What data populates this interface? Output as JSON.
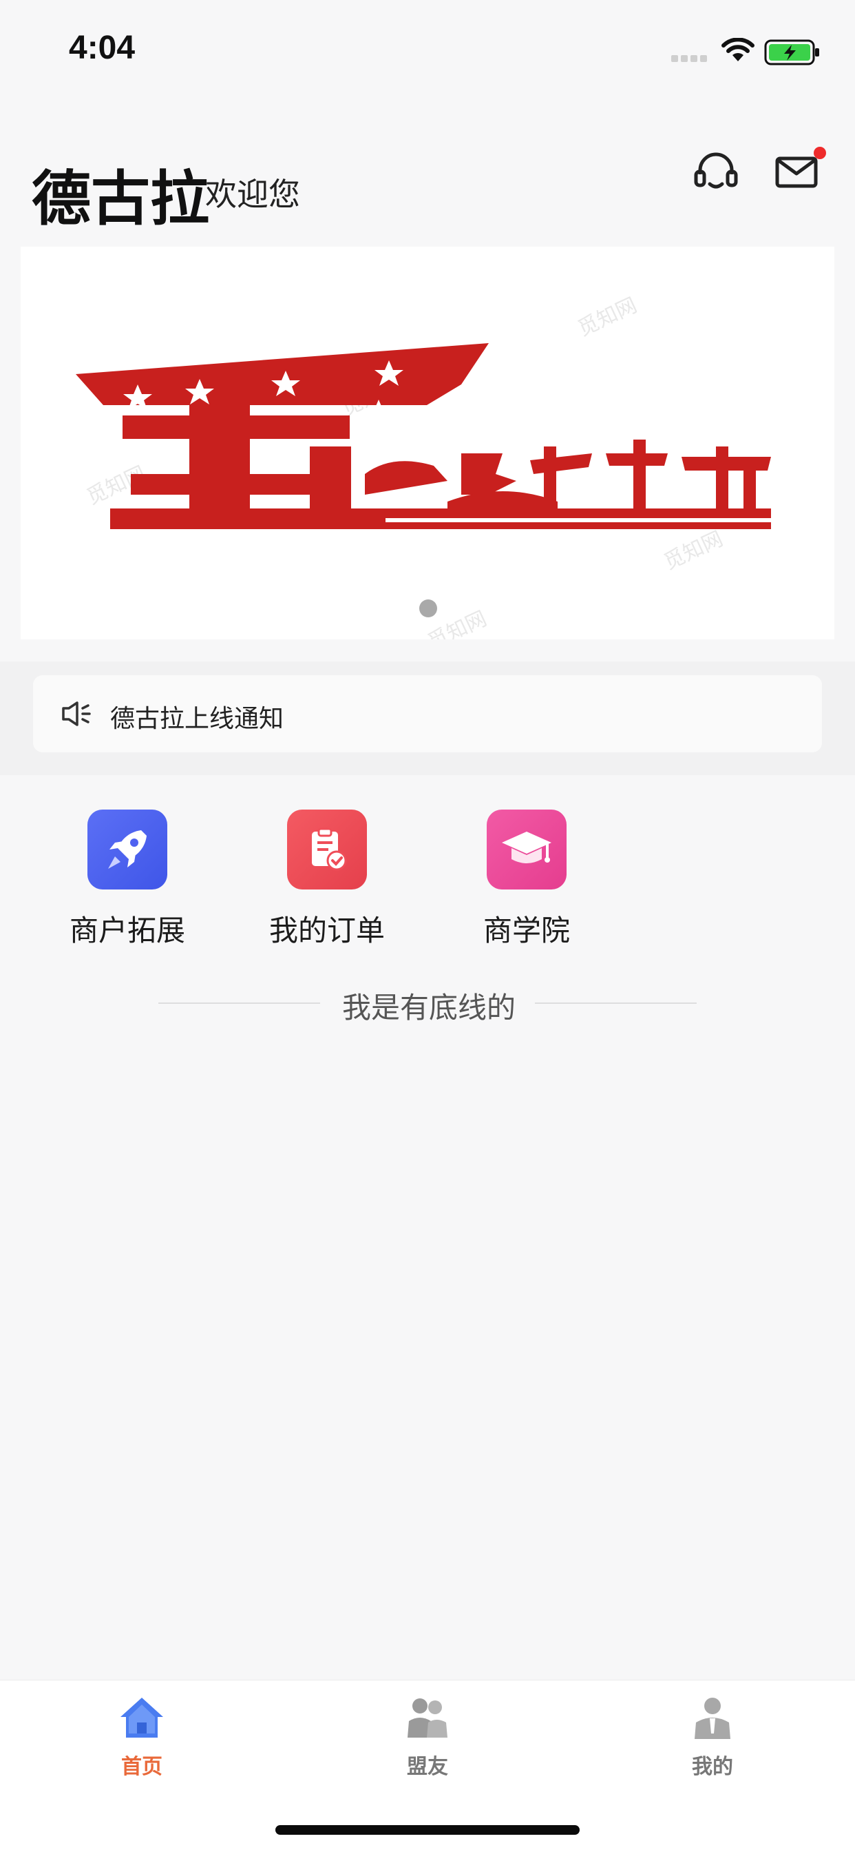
{
  "status_bar": {
    "time": "4:04"
  },
  "header": {
    "brand": "德古拉",
    "welcome": "欢迎您"
  },
  "banner": {
    "image_text": "五劳动节",
    "active_slide": 1,
    "slide_count": 1,
    "watermark": "觅知网",
    "colors": {
      "primary": "#c8201e"
    }
  },
  "notice": {
    "text": "德古拉上线通知",
    "icon": "speaker-icon"
  },
  "menu": {
    "items": [
      {
        "label": "商户拓展",
        "icon": "rocket-icon",
        "color": "#4f62f0"
      },
      {
        "label": "我的订单",
        "icon": "order-clipboard-icon",
        "color": "#ef4d58"
      },
      {
        "label": "商学院",
        "icon": "graduation-cap-icon",
        "color": "#ee4b9b"
      }
    ]
  },
  "footer_line": {
    "text": "我是有底线的"
  },
  "tabs": [
    {
      "label": "首页",
      "icon": "home-icon",
      "active": true,
      "color": "#e9693a"
    },
    {
      "label": "盟友",
      "icon": "friends-icon",
      "active": false,
      "color": "#777777"
    },
    {
      "label": "我的",
      "icon": "profile-icon",
      "active": false,
      "color": "#777777"
    }
  ],
  "colors": {
    "accent": "#4a7cf0",
    "active_tab_text": "#e9693a"
  }
}
